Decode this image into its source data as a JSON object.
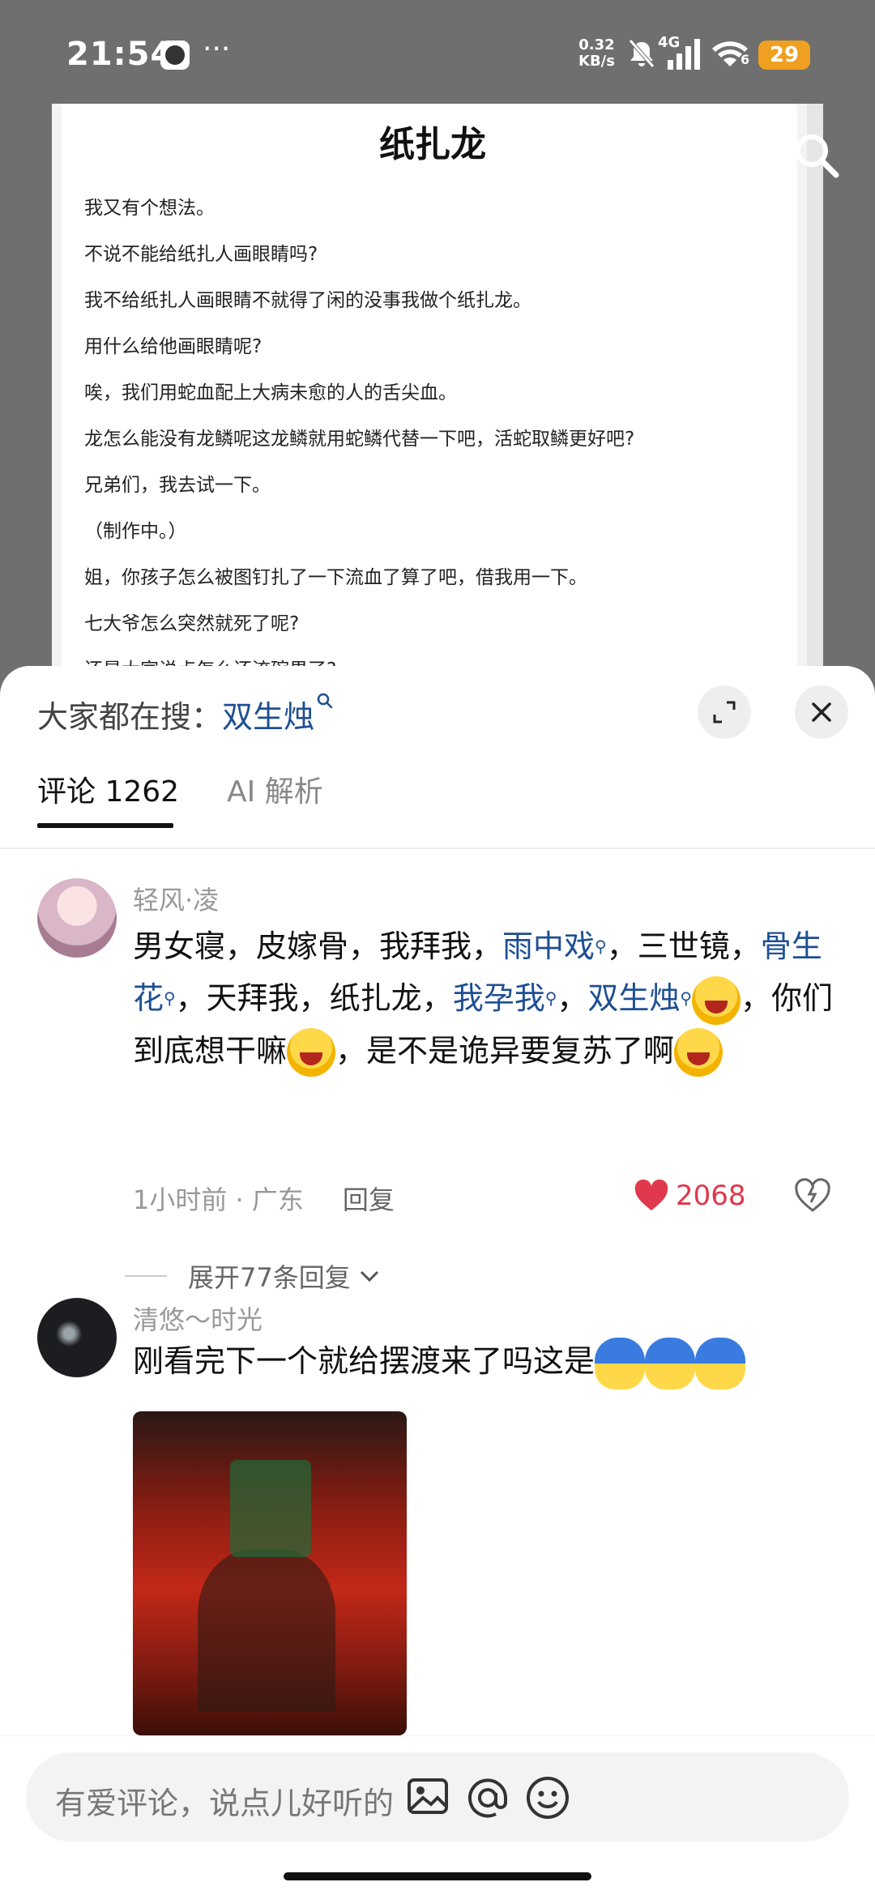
{
  "status_bar": {
    "time": "21:54",
    "net_speed_value": "0.32",
    "net_speed_unit": "KB/s",
    "signal_type": "4G",
    "wifi_label": "6",
    "battery": "29"
  },
  "document": {
    "title": "纸扎龙",
    "lines": [
      "我又有个想法。",
      "不说不能给纸扎人画眼睛吗?",
      "我不给纸扎人画眼睛不就得了闲的没事我做个纸扎龙。",
      "用什么给他画眼睛呢?",
      "唉，我们用蛇血配上大病未愈的人的舌尖血。",
      "龙怎么能没有龙鳞呢这龙鳞就用蛇鳞代替一下吧，活蛇取鳞更好吧?",
      "兄弟们，我去试一下。",
      "（制作中。）",
      "姐，你孩子怎么被图钉扎了一下流血了算了吧，借我用一下。",
      "七大爷怎么突然就死了呢?",
      "还是大家说点怎么还流碗果了?"
    ]
  },
  "sheet": {
    "trending_prefix": "大家都在搜：",
    "trending_keyword": "双生烛",
    "tabs": {
      "comments": "评论 1262",
      "ai": "AI 解析"
    },
    "comments": [
      {
        "username": "轻风·凌",
        "text_parts": [
          "男女寝，皮嫁骨，我拜我，",
          "雨中戏",
          "，三世镜，",
          "骨生花",
          "，天拜我，纸扎龙，",
          "我孕我",
          "，",
          "双生烛",
          "，你们到底想干嘛",
          "，是不是诡异要复苏了啊"
        ],
        "time_location": "1小时前 · 广东",
        "reply_label": "回复",
        "likes": "2068",
        "expand_label": "展开77条回复"
      },
      {
        "username": "清悠～时光",
        "text": "刚看完下一个就给摆渡来了吗这是"
      }
    ],
    "composer": {
      "placeholder": "有爱评论，说点儿好听的"
    }
  },
  "colors": {
    "keyword": "#1e4f93",
    "like": "#e0384c",
    "battery": "#f0a020"
  }
}
